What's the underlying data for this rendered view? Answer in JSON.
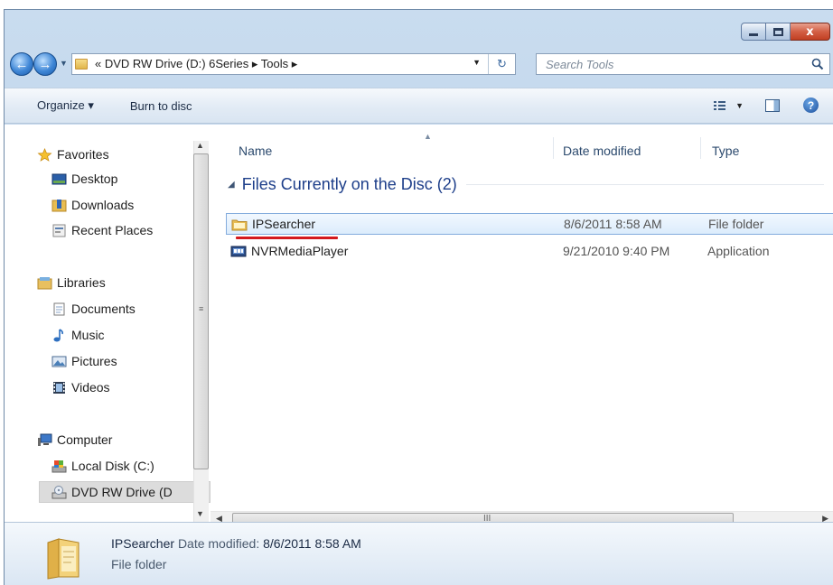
{
  "window": {
    "controls": {
      "minimize": "minimize",
      "maximize": "maximize",
      "close": "x"
    }
  },
  "navigation": {
    "back_glyph": "←",
    "forward_glyph": "→",
    "address_text": "« DVD RW Drive (D:) 6Series ▸ Tools ▸",
    "refresh_glyph": "↻",
    "search_placeholder": "Search Tools"
  },
  "toolbar": {
    "organize_label": "Organize ▾",
    "burn_label": "Burn to disc",
    "help_glyph": "?"
  },
  "nav_pane": {
    "favorites": {
      "label": "Favorites",
      "items": [
        "Desktop",
        "Downloads",
        "Recent Places"
      ]
    },
    "libraries": {
      "label": "Libraries",
      "items": [
        "Documents",
        "Music",
        "Pictures",
        "Videos"
      ]
    },
    "computer": {
      "label": "Computer",
      "items": [
        "Local Disk (C:)",
        "DVD RW Drive (D"
      ]
    },
    "selected_item": "DVD RW Drive (D"
  },
  "columns": {
    "name": "Name",
    "date": "Date modified",
    "type": "Type"
  },
  "group": {
    "label": "Files Currently on the Disc (2)"
  },
  "files": [
    {
      "name": "IPSearcher",
      "date": "8/6/2011 8:58 AM",
      "type": "File folder",
      "icon": "folder-icon",
      "selected": true
    },
    {
      "name": "NVRMediaPlayer",
      "date": "9/21/2010 9:40 PM",
      "type": "Application",
      "icon": "application-icon",
      "selected": false
    }
  ],
  "scrollbar": {
    "grip": "III"
  },
  "details": {
    "name": "IPSearcher",
    "date_label": "Date modified:",
    "date_value": "8/6/2011 8:58 AM",
    "type": "File folder"
  },
  "colors": {
    "selection_border": "#84acdd",
    "annotation_underline": "#d4191d",
    "group_header": "#1e3f8a"
  }
}
